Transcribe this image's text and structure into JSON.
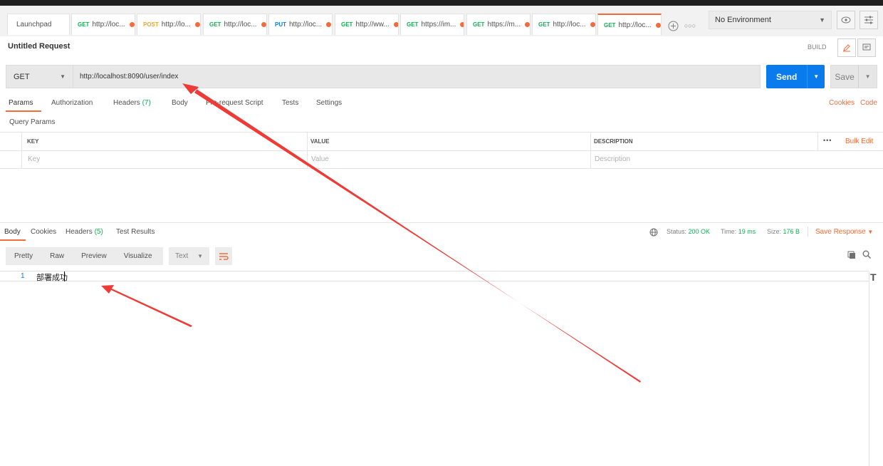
{
  "tabs": [
    {
      "method": "",
      "label": "Launchpad",
      "dot": false,
      "active": false
    },
    {
      "method": "GET",
      "label": "http://loc...",
      "dot": true,
      "active": false
    },
    {
      "method": "POST",
      "label": "http://lo...",
      "dot": true,
      "active": false
    },
    {
      "method": "GET",
      "label": "http://loc...",
      "dot": true,
      "active": false
    },
    {
      "method": "PUT",
      "label": "http://loc...",
      "dot": true,
      "active": false
    },
    {
      "method": "GET",
      "label": "http://ww...",
      "dot": true,
      "active": false
    },
    {
      "method": "GET",
      "label": "https://im...",
      "dot": true,
      "active": false
    },
    {
      "method": "GET",
      "label": "https://m...",
      "dot": true,
      "active": false
    },
    {
      "method": "GET",
      "label": "http://loc...",
      "dot": true,
      "active": false
    },
    {
      "method": "GET",
      "label": "http://loc...",
      "dot": true,
      "active": true
    }
  ],
  "environment": {
    "selected": "No Environment"
  },
  "request": {
    "title": "Untitled Request",
    "build_label": "BUILD",
    "method": "GET",
    "url": "http://localhost:8090/user/index",
    "send_label": "Send",
    "save_label": "Save"
  },
  "request_tabs": {
    "params": "Params",
    "authorization": "Authorization",
    "headers": "Headers",
    "headers_count": "(7)",
    "body": "Body",
    "prerequest": "Pre-request Script",
    "tests": "Tests",
    "settings": "Settings",
    "cookies_link": "Cookies",
    "code_link": "Code"
  },
  "query_params": {
    "title": "Query Params",
    "columns": [
      "KEY",
      "VALUE",
      "DESCRIPTION"
    ],
    "placeholders": [
      "Key",
      "Value",
      "Description"
    ],
    "bulk_edit": "Bulk Edit"
  },
  "response": {
    "tabs": {
      "body": "Body",
      "cookies": "Cookies",
      "headers": "Headers",
      "headers_count": "(5)",
      "test_results": "Test Results"
    },
    "status_label": "Status:",
    "status_value": "200 OK",
    "time_label": "Time:",
    "time_value": "19 ms",
    "size_label": "Size:",
    "size_value": "176 B",
    "save_response": "Save Response",
    "formats": [
      "Pretty",
      "Raw",
      "Preview",
      "Visualize"
    ],
    "type": "Text",
    "line_number": "1",
    "content": "部署成功"
  },
  "colors": {
    "accent": "#f26b3a",
    "send": "#097bed",
    "success": "#0cb354",
    "annotation": "#ef3b36"
  }
}
